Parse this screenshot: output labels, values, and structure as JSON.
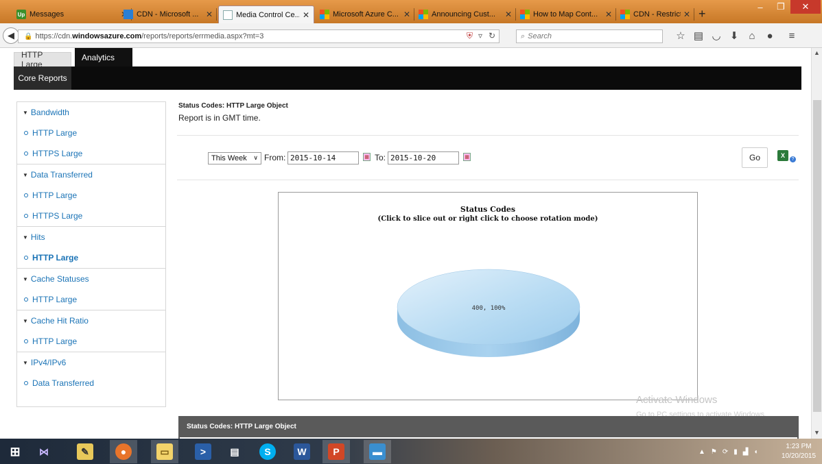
{
  "browser": {
    "tabs": [
      {
        "label": "Messages",
        "favicon": "up-icon",
        "active": false
      },
      {
        "label": "CDN - Microsoft ...",
        "favicon": "azure-icon",
        "active": false
      },
      {
        "label": "Media Control Ce...",
        "favicon": "page-icon",
        "active": true
      },
      {
        "label": "Microsoft Azure C...",
        "favicon": "microsoft-icon",
        "active": false
      },
      {
        "label": "Announcing Cust...",
        "favicon": "microsoft-icon",
        "active": false
      },
      {
        "label": "How to Map Cont...",
        "favicon": "microsoft-icon",
        "active": false
      },
      {
        "label": "CDN - Restrict acc...",
        "favicon": "microsoft-icon",
        "active": false
      }
    ],
    "up_favicon_text": "Up",
    "new_tab": "+",
    "window_controls": {
      "minimize": "–",
      "restore": "❐",
      "close": "✕"
    },
    "url_prefix": "https://cdn.",
    "url_domain": "windowsazure.com",
    "url_path": "/reports/reports/errmedia.aspx?mt=3",
    "search_placeholder": "Search",
    "toolbar_icons": [
      "star-icon",
      "reading-list-icon",
      "pocket-icon",
      "download-icon",
      "home-icon",
      "chat-icon",
      "menu-icon"
    ]
  },
  "app": {
    "top_tabs": [
      "HTTP Large",
      "Analytics"
    ],
    "sub_tab": "Core Reports",
    "sidebar": [
      {
        "heading": "Bandwidth",
        "items": [
          {
            "label": "HTTP Large",
            "active": false
          },
          {
            "label": "HTTPS Large",
            "active": false
          }
        ]
      },
      {
        "heading": "Data Transferred",
        "items": [
          {
            "label": "HTTP Large",
            "active": false
          },
          {
            "label": "HTTPS Large",
            "active": false
          }
        ]
      },
      {
        "heading": "Hits",
        "items": [
          {
            "label": "HTTP Large",
            "active": true
          }
        ]
      },
      {
        "heading": "Cache Statuses",
        "items": [
          {
            "label": "HTTP Large",
            "active": false
          }
        ]
      },
      {
        "heading": "Cache Hit Ratio",
        "items": [
          {
            "label": "HTTP Large",
            "active": false
          }
        ]
      },
      {
        "heading": "IPv4/IPv6",
        "items": [
          {
            "label": "Data Transferred",
            "active": false
          }
        ]
      }
    ],
    "report": {
      "title": "Status Codes: HTTP Large Object",
      "note": "Report is in GMT time.",
      "range": "This Week",
      "from_label": "From:",
      "from_value": "2015-10-14",
      "to_label": "To:",
      "to_value": "2015-10-20",
      "go_label": "Go",
      "bottom_bar_title": "Status Codes: HTTP Large Object"
    },
    "watermark": {
      "line1": "Activate Windows",
      "line2": "Go to PC settings to activate Windows."
    }
  },
  "chart_data": {
    "type": "pie",
    "title": "Status Codes",
    "subtitle": "(Click to slice out or right click to choose rotation mode)",
    "categories": [
      "400"
    ],
    "values": [
      100
    ],
    "data_labels": [
      "400, 100%"
    ],
    "colors": [
      "#b9dcf3"
    ]
  },
  "taskbar": {
    "apps": [
      "windows-start-icon",
      "visual-studio-icon",
      "tool-icon",
      "firefox-icon",
      "file-explorer-icon",
      "powershell-icon",
      "documents-icon",
      "skype-icon",
      "word-icon",
      "powerpoint-icon",
      "remote-desktop-icon"
    ],
    "clock_time": "1:23 PM",
    "clock_date": "10/20/2015"
  }
}
